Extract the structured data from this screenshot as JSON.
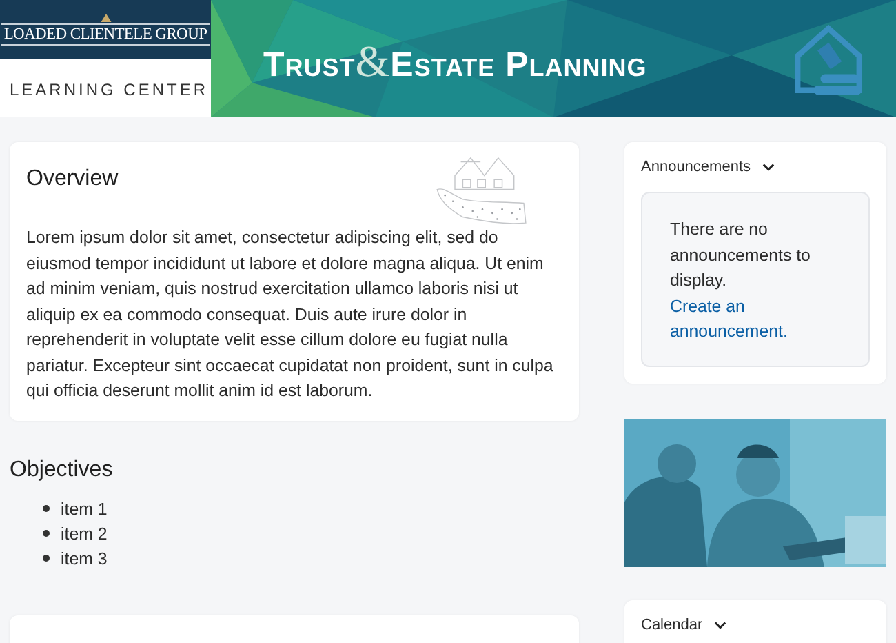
{
  "banner": {
    "logo": "LOADED CLIENTELE GROUP",
    "subtitle": "LEARNING CENTER",
    "title": {
      "before": "Trust",
      "ampersand": "&",
      "after": "Estate Planning"
    }
  },
  "overview": {
    "heading": "Overview",
    "text": "Lorem ipsum dolor sit amet, consectetur adipiscing elit, sed do eiusmod tempor incididunt ut labore et dolore magna aliqua. Ut enim ad minim veniam, quis nostrud exercitation ullamco laboris nisi ut aliquip ex ea commodo consequat. Duis aute irure dolor in reprehenderit in voluptate velit esse cillum dolore eu fugiat nulla pariatur. Excepteur sint occaecat cupidatat non proident, sunt in culpa qui officia deserunt mollit anim id est laborum."
  },
  "objectives": {
    "heading": "Objectives",
    "items": [
      "item 1",
      "item 2",
      "item 3"
    ]
  },
  "announcements": {
    "heading": "Announcements",
    "message": "There are no announcements to display.",
    "link": "Create an announcement."
  },
  "calendar": {
    "heading": "Calendar"
  }
}
